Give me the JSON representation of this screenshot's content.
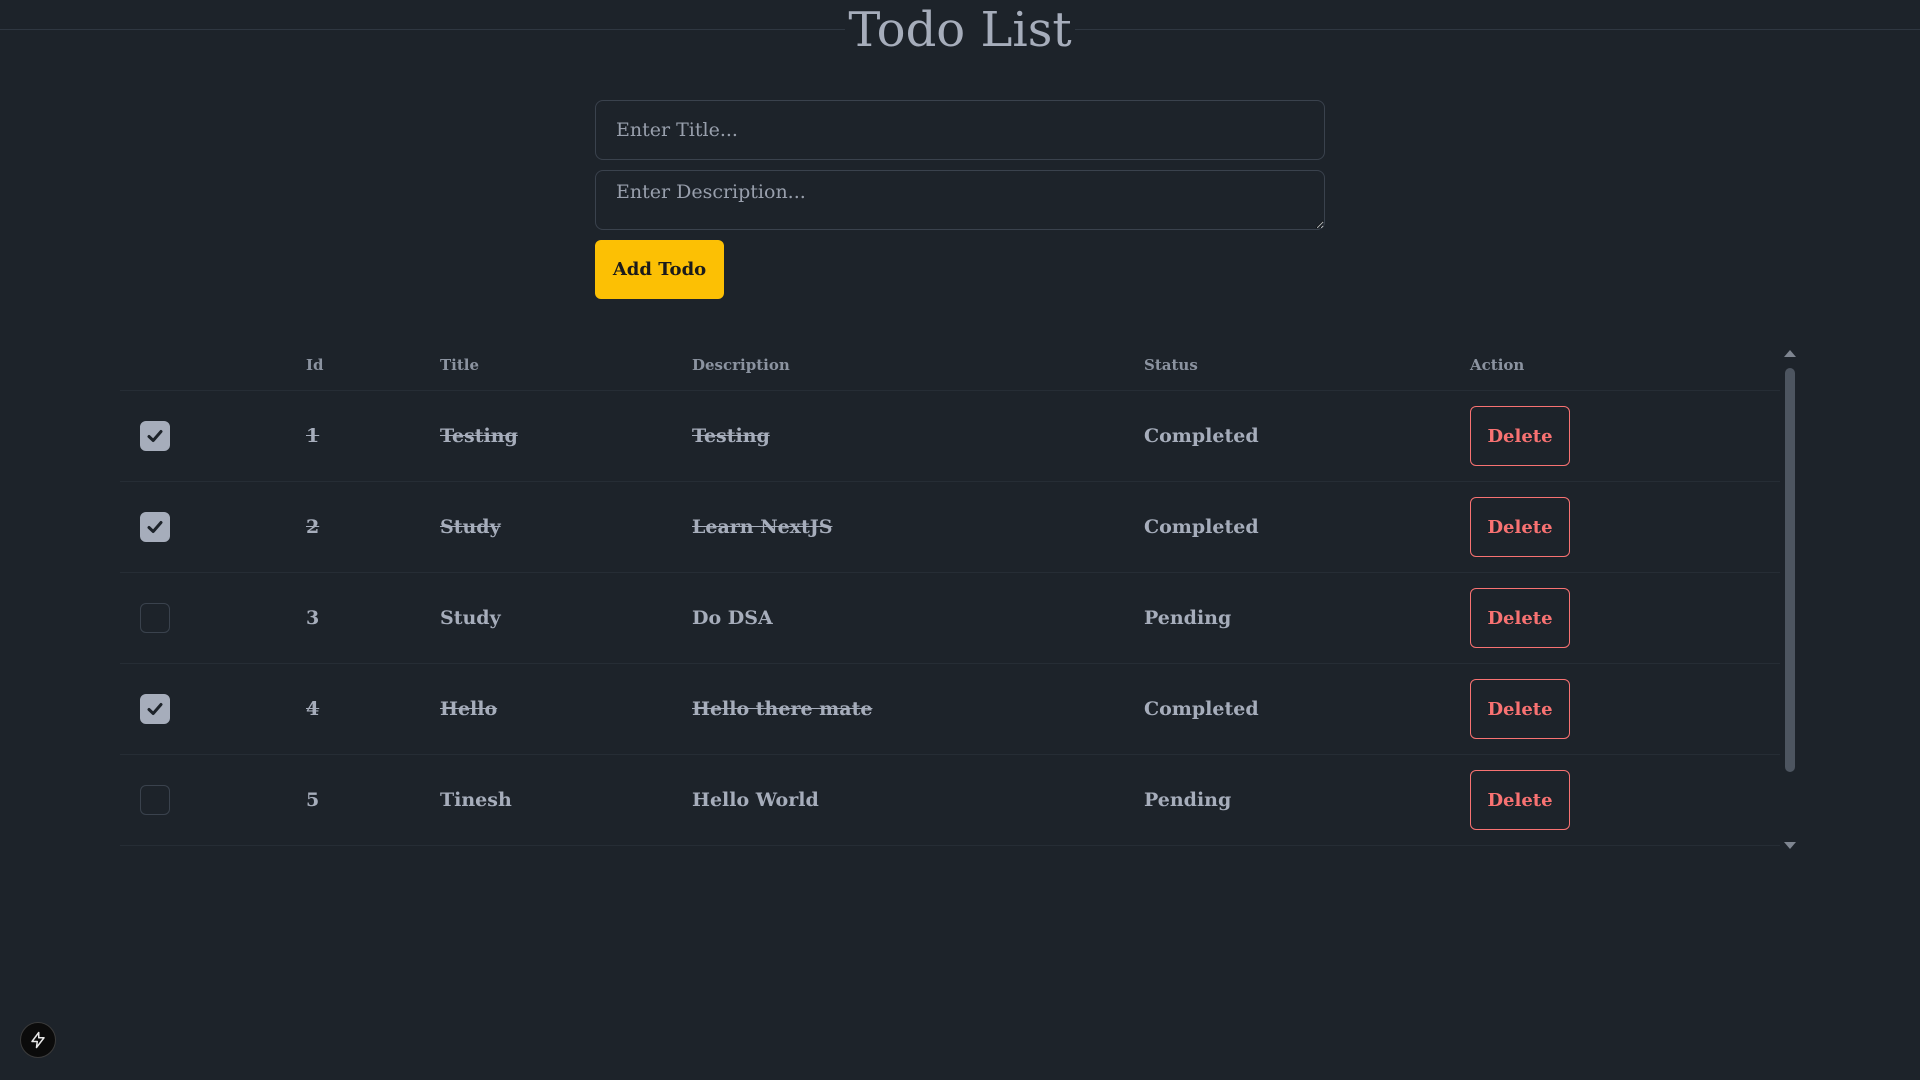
{
  "header": {
    "title": "Todo List"
  },
  "form": {
    "title_placeholder": "Enter Title...",
    "description_placeholder": "Enter Description...",
    "add_label": "Add Todo"
  },
  "table": {
    "headers": {
      "id": "Id",
      "title": "Title",
      "description": "Description",
      "status": "Status",
      "action": "Action"
    },
    "rows": [
      {
        "id": "1",
        "title": "Testing",
        "description": "Testing",
        "status": "Completed",
        "completed": true,
        "action": "Delete"
      },
      {
        "id": "2",
        "title": "Study",
        "description": "Learn NextJS",
        "status": "Completed",
        "completed": true,
        "action": "Delete"
      },
      {
        "id": "3",
        "title": "Study",
        "description": "Do DSA",
        "status": "Pending",
        "completed": false,
        "action": "Delete"
      },
      {
        "id": "4",
        "title": "Hello",
        "description": "Hello there mate",
        "status": "Completed",
        "completed": true,
        "action": "Delete"
      },
      {
        "id": "5",
        "title": "Tinesh",
        "description": "Hello World",
        "status": "Pending",
        "completed": false,
        "action": "Delete"
      }
    ]
  },
  "colors": {
    "background": "#1d232a",
    "text": "#a6adbb",
    "accent_button": "#fcc004",
    "delete": "#f87272"
  },
  "icons": {
    "checkbox_check": "check-icon",
    "dev_indicator": "lightning-bolt-icon"
  }
}
